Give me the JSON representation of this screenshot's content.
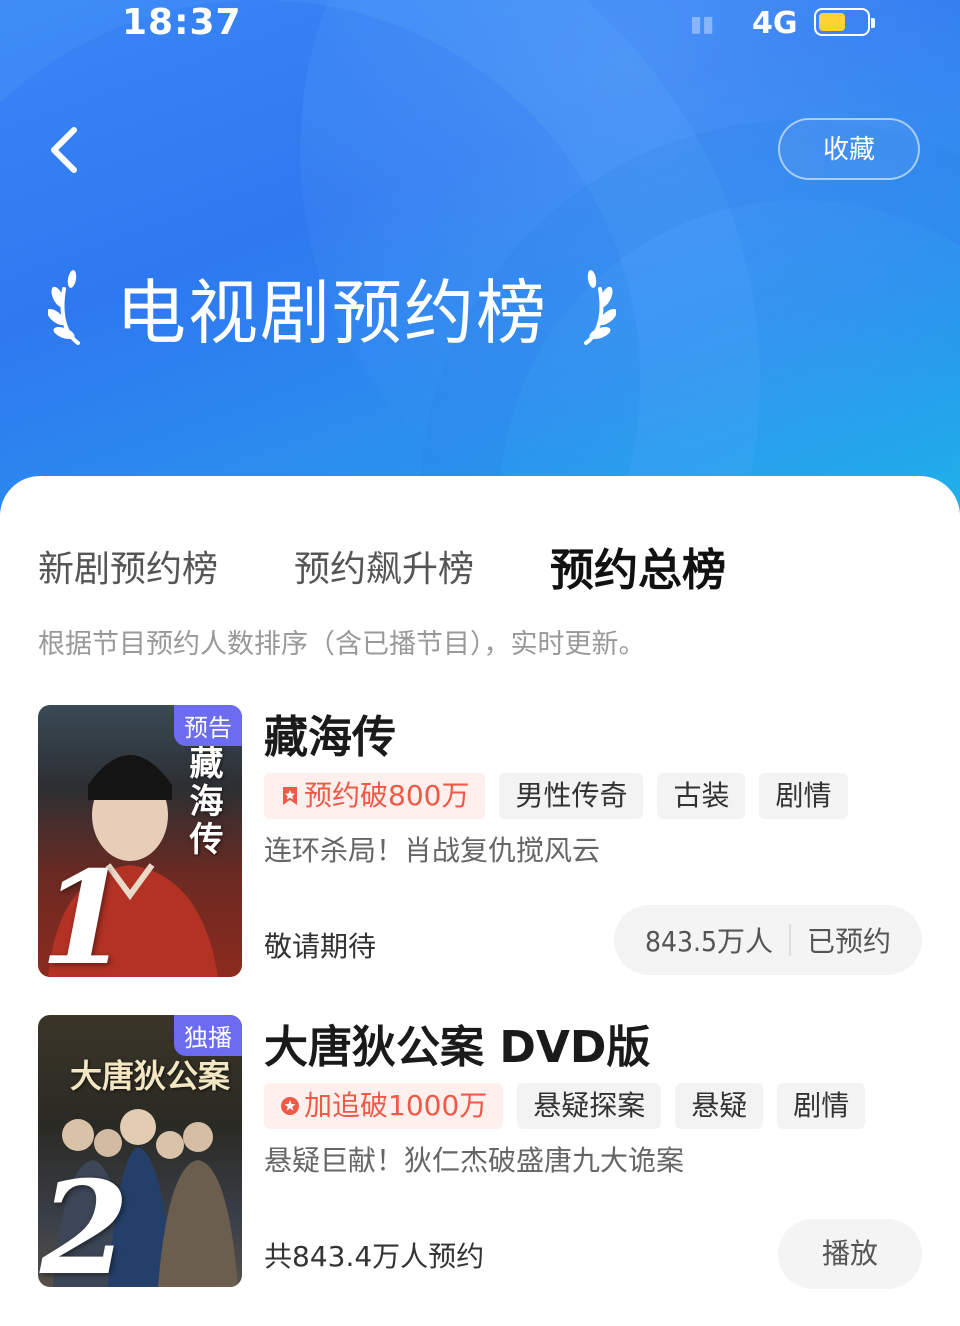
{
  "status_bar": {
    "time": "18:37",
    "signal": "4G"
  },
  "header": {
    "favorite_label": "收藏",
    "title": "电视剧预约榜"
  },
  "tabs": [
    {
      "label": "新剧预约榜",
      "active": false
    },
    {
      "label": "预约飙升榜",
      "active": false
    },
    {
      "label": "预约总榜",
      "active": true
    }
  ],
  "description": "根据节目预约人数排序（含已播节目），实时更新。",
  "items": [
    {
      "rank": "1",
      "badge": "预告",
      "poster_text": "藏海传",
      "title": "藏海传",
      "hot_tag": "预约破800万",
      "tags": [
        "男性传奇",
        "古装",
        "剧情"
      ],
      "subtitle": "连环杀局！肖战复仇搅风云",
      "status": "敬请期待",
      "count": "843.5万人",
      "action": "已预约"
    },
    {
      "rank": "2",
      "badge": "独播",
      "poster_text": "大唐狄公案",
      "title": "大唐狄公案 DVD版",
      "hot_tag": "加追破1000万",
      "tags": [
        "悬疑探案",
        "悬疑",
        "剧情"
      ],
      "subtitle": "悬疑巨献！狄仁杰破盛唐九大诡案",
      "status": "共843.4万人预约",
      "action": "播放"
    }
  ],
  "colors": {
    "accent_blue": "#2f78f0",
    "hot_red": "#ef5a48",
    "badge_purple": "#6b6cf0"
  }
}
